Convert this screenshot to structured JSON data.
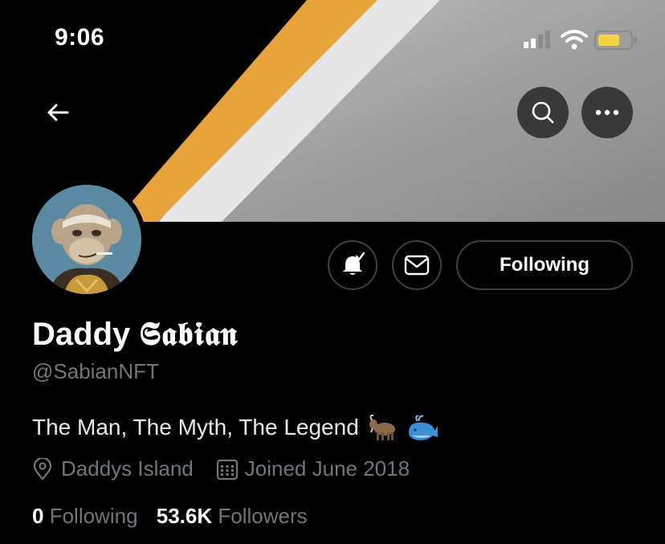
{
  "status_bar": {
    "time": "9:06"
  },
  "header": {
    "back_icon": "arrow-left-icon",
    "search_icon": "search-icon",
    "more_icon": "more-horizontal-icon"
  },
  "profile": {
    "name": "Daddy",
    "name_styled": "𝕾𝖆𝖇𝖎𝖆𝖓",
    "handle": "@SabianNFT",
    "bio": "The Man, The Myth, The Legend",
    "bio_emoji": [
      "goat",
      "whale"
    ],
    "location": "Daddys Island",
    "joined": "Joined June 2018",
    "following_count": "0",
    "following_label": "Following",
    "followers_count": "53.6K",
    "followers_label": "Followers"
  },
  "actions": {
    "notifications_icon": "bell-check-icon",
    "message_icon": "envelope-icon",
    "follow_button_label": "Following"
  },
  "colors": {
    "background": "#000000",
    "text_primary": "#e7e9ea",
    "text_secondary": "#71767b",
    "battery": "#f5d33c",
    "banner_orange": "#e8a33a",
    "banner_gray": "#9e9e9e"
  }
}
